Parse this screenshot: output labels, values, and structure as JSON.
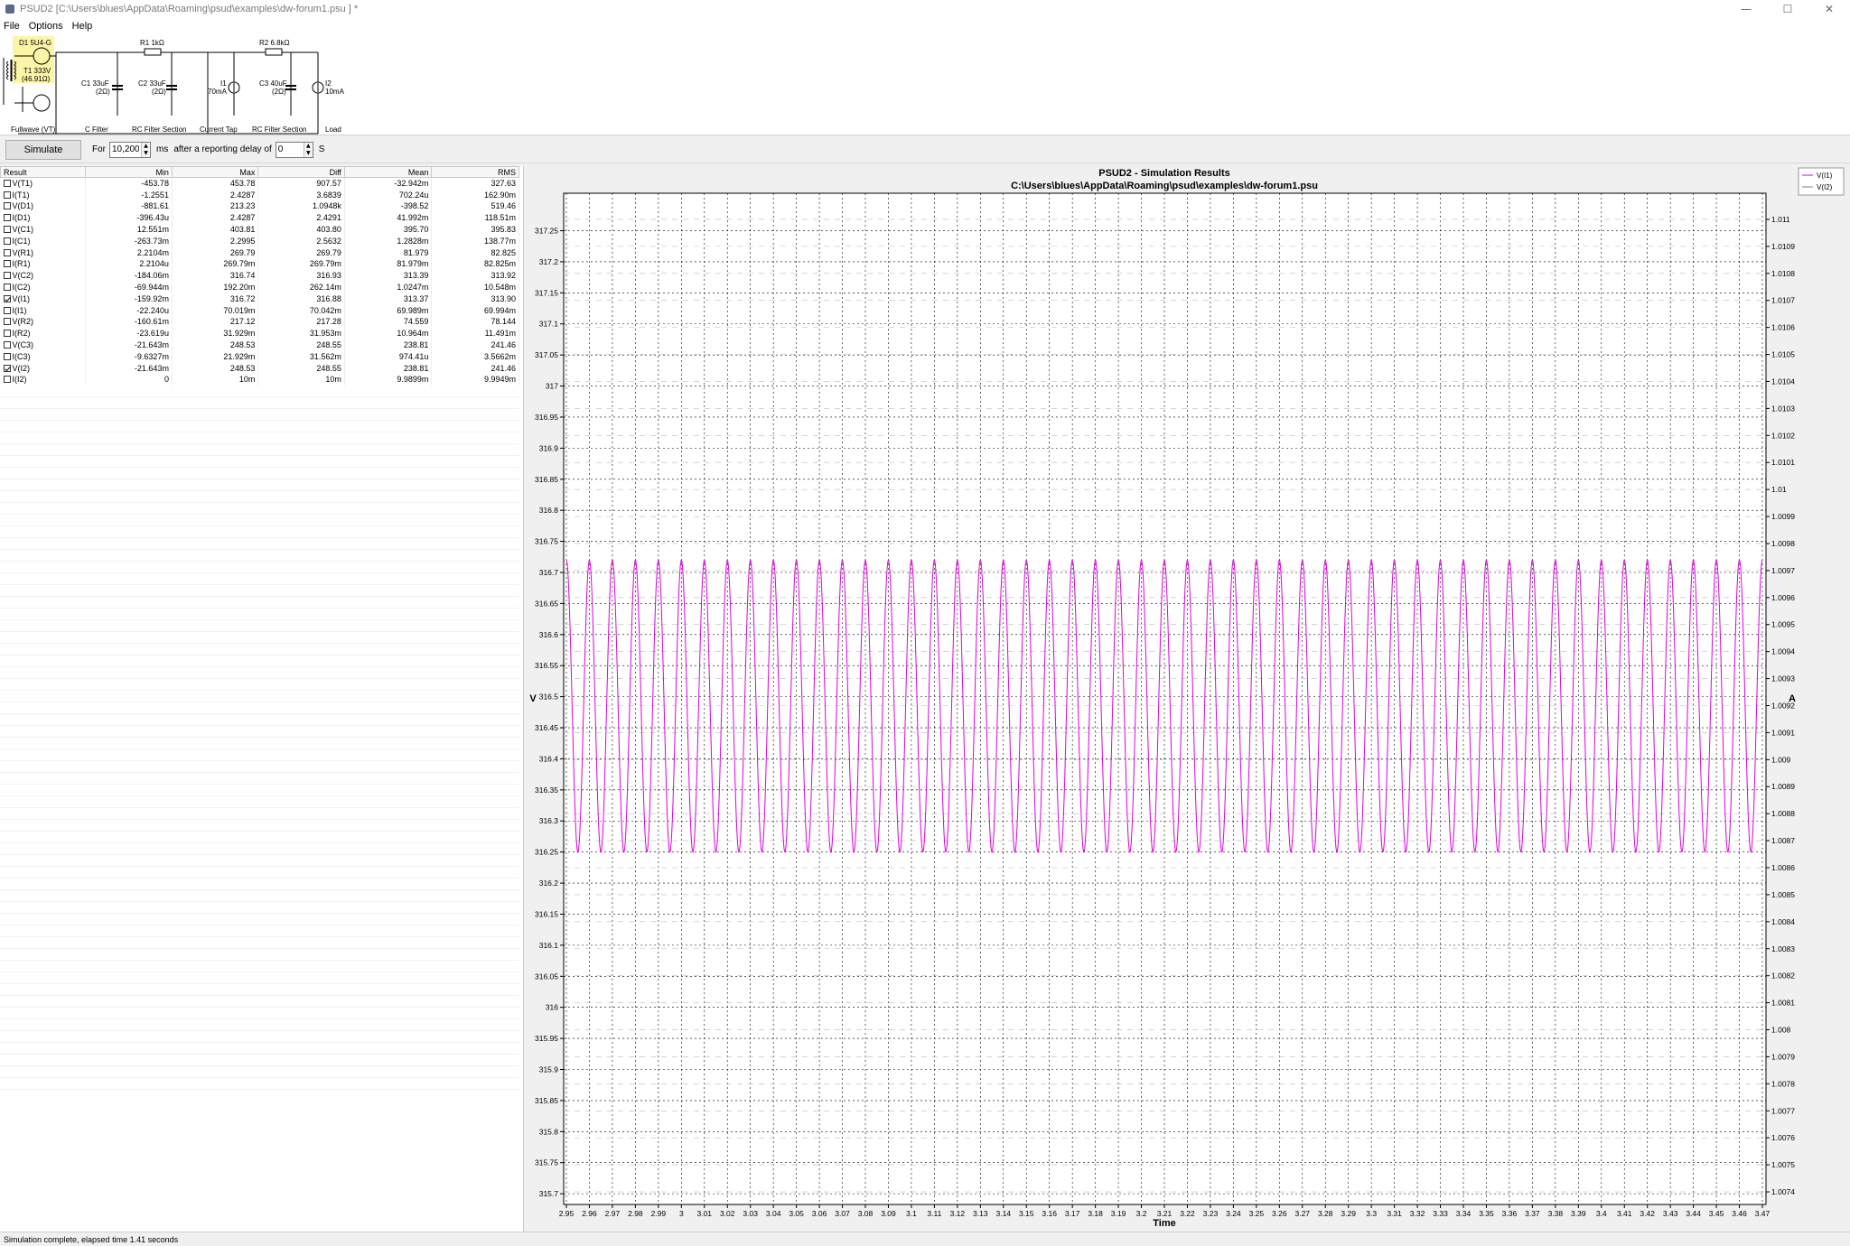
{
  "window": {
    "title": "PSUD2  [C:\\Users\\blues\\AppData\\Roaming\\psud\\examples\\dw-forum1.psu ] *",
    "minimize_glyph": "—",
    "maximize_glyph": "☐",
    "close_glyph": "✕"
  },
  "menu": [
    "File",
    "Options",
    "Help"
  ],
  "schematic": {
    "components": {
      "d1": "D1 5U4-G",
      "t1_name": "T1 333V",
      "t1_res": "(46.91Ω)",
      "c1_val": "C1 33uF",
      "c1_res": "(2Ω)",
      "r1": "R1 1kΩ",
      "c2_val": "C2 33uF",
      "c2_res": "(2Ω)",
      "i1_name": "I1",
      "i1_val": "70mA",
      "r2": "R2 6.8kΩ",
      "c3_val": "C3 40uF",
      "c3_res": "(2Ω)",
      "i2_name": "I2",
      "i2_val": "10mA"
    },
    "sections": [
      "Fullwave (VT)",
      "C Filter",
      "RC Filter Section",
      "Current Tap",
      "RC Filter Section",
      "Load"
    ],
    "highlight_color": "#fdf5a6"
  },
  "toolbar": {
    "simulate_label": "Simulate",
    "for_label": "For",
    "duration_value": "10,200",
    "ms_label": "ms",
    "delay_label": "after a reporting delay of",
    "delay_value": "0",
    "s_label": "S",
    "spin_up": "▲",
    "spin_down": "▼"
  },
  "results": {
    "headers": [
      "Result",
      "Min",
      "Max",
      "Diff",
      "Mean",
      "RMS"
    ],
    "rows": [
      {
        "name": "V(T1)",
        "checked": false,
        "min": "-453.78",
        "max": "453.78",
        "diff": "907.57",
        "mean": "-32.942m",
        "rms": "327.63"
      },
      {
        "name": "I(T1)",
        "checked": false,
        "min": "-1.2551",
        "max": "2.4287",
        "diff": "3.6839",
        "mean": "702.24u",
        "rms": "162.90m"
      },
      {
        "name": "V(D1)",
        "checked": false,
        "min": "-881.61",
        "max": "213.23",
        "diff": "1.0948k",
        "mean": "-398.52",
        "rms": "519.46"
      },
      {
        "name": "I(D1)",
        "checked": false,
        "min": "-396.43u",
        "max": "2.4287",
        "diff": "2.4291",
        "mean": "41.992m",
        "rms": "118.51m"
      },
      {
        "name": "V(C1)",
        "checked": false,
        "min": "12.551m",
        "max": "403.81",
        "diff": "403.80",
        "mean": "395.70",
        "rms": "395.83"
      },
      {
        "name": "I(C1)",
        "checked": false,
        "min": "-263.73m",
        "max": "2.2995",
        "diff": "2.5632",
        "mean": "1.2828m",
        "rms": "138.77m"
      },
      {
        "name": "V(R1)",
        "checked": false,
        "min": "2.2104m",
        "max": "269.79",
        "diff": "269.79",
        "mean": "81.979",
        "rms": "82.825"
      },
      {
        "name": "I(R1)",
        "checked": false,
        "min": "2.2104u",
        "max": "269.79m",
        "diff": "269.79m",
        "mean": "81.979m",
        "rms": "82.825m"
      },
      {
        "name": "V(C2)",
        "checked": false,
        "min": "-184.06m",
        "max": "316.74",
        "diff": "316.93",
        "mean": "313.39",
        "rms": "313.92"
      },
      {
        "name": "I(C2)",
        "checked": false,
        "min": "-69.944m",
        "max": "192.20m",
        "diff": "262.14m",
        "mean": "1.0247m",
        "rms": "10.548m"
      },
      {
        "name": "V(I1)",
        "checked": true,
        "min": "-159.92m",
        "max": "316.72",
        "diff": "316.88",
        "mean": "313.37",
        "rms": "313.90"
      },
      {
        "name": "I(I1)",
        "checked": false,
        "min": "-22.240u",
        "max": "70.019m",
        "diff": "70.042m",
        "mean": "69.989m",
        "rms": "69.994m"
      },
      {
        "name": "V(R2)",
        "checked": false,
        "min": "-160.61m",
        "max": "217.12",
        "diff": "217.28",
        "mean": "74.559",
        "rms": "78.144"
      },
      {
        "name": "I(R2)",
        "checked": false,
        "min": "-23.619u",
        "max": "31.929m",
        "diff": "31.953m",
        "mean": "10.964m",
        "rms": "11.491m"
      },
      {
        "name": "V(C3)",
        "checked": false,
        "min": "-21.643m",
        "max": "248.53",
        "diff": "248.55",
        "mean": "238.81",
        "rms": "241.46"
      },
      {
        "name": "I(C3)",
        "checked": false,
        "min": "-9.6327m",
        "max": "21.929m",
        "diff": "31.562m",
        "mean": "974.41u",
        "rms": "3.5662m"
      },
      {
        "name": "V(I2)",
        "checked": true,
        "min": "-21.643m",
        "max": "248.53",
        "diff": "248.55",
        "mean": "238.81",
        "rms": "241.46"
      },
      {
        "name": "I(I2)",
        "checked": false,
        "min": "0",
        "max": "10m",
        "diff": "10m",
        "mean": "9.9899m",
        "rms": "9.9949m"
      }
    ]
  },
  "chart_data": {
    "type": "line",
    "title": "PSUD2 - Simulation Results",
    "subtitle": "C:\\Users\\blues\\AppData\\Roaming\\psud\\examples\\dw-forum1.psu",
    "xlabel": "Time",
    "ylabel": "V",
    "y2label": "A",
    "xlim": [
      2.95,
      3.47
    ],
    "x_ticks": [
      2.95,
      2.96,
      2.97,
      2.98,
      2.99,
      3,
      3.01,
      3.02,
      3.03,
      3.04,
      3.05,
      3.06,
      3.07,
      3.08,
      3.09,
      3.1,
      3.11,
      3.12,
      3.13,
      3.14,
      3.15,
      3.16,
      3.17,
      3.18,
      3.19,
      3.2,
      3.21,
      3.22,
      3.23,
      3.24,
      3.25,
      3.26,
      3.27,
      3.28,
      3.29,
      3.3,
      3.31,
      3.32,
      3.33,
      3.34,
      3.35,
      3.36,
      3.37,
      3.38,
      3.39,
      3.4,
      3.41,
      3.42,
      3.43,
      3.44,
      3.45,
      3.46,
      3.47
    ],
    "ylim": [
      315.69,
      317.29
    ],
    "y_ticks": [
      315.7,
      315.75,
      315.8,
      315.85,
      315.9,
      315.95,
      316,
      316.05,
      316.1,
      316.15,
      316.2,
      316.25,
      316.3,
      316.35,
      316.4,
      316.45,
      316.5,
      316.55,
      316.6,
      316.65,
      316.7,
      316.75,
      316.8,
      316.85,
      316.9,
      316.95,
      317,
      317.05,
      317.1,
      317.15,
      317.2,
      317.25
    ],
    "y2lim": [
      1.00737,
      1.01105
    ],
    "y2_ticks": [
      1.0074,
      1.0075,
      1.0076,
      1.0077,
      1.0078,
      1.0079,
      1.008,
      1.0081,
      1.0082,
      1.0083,
      1.0084,
      1.0085,
      1.0086,
      1.0087,
      1.0088,
      1.0089,
      1.009,
      1.0091,
      1.0092,
      1.0093,
      1.0094,
      1.0095,
      1.0096,
      1.0097,
      1.0098,
      1.0099,
      1.01,
      1.0101,
      1.0102,
      1.0103,
      1.0104,
      1.0105,
      1.0106,
      1.0107,
      1.0108,
      1.0109,
      1.011
    ],
    "grid": true,
    "legend_placement": "top-right",
    "series": [
      {
        "name": "V(I1)",
        "color": "#e000e0",
        "axis": "left",
        "ripple_min": 316.25,
        "ripple_max": 316.72,
        "frequency_hz": 100
      },
      {
        "name": "V(I2)",
        "color": "#808080",
        "axis": "left",
        "note_visible": false
      }
    ]
  },
  "status": "Simulation complete, elapsed time 1.41 seconds"
}
